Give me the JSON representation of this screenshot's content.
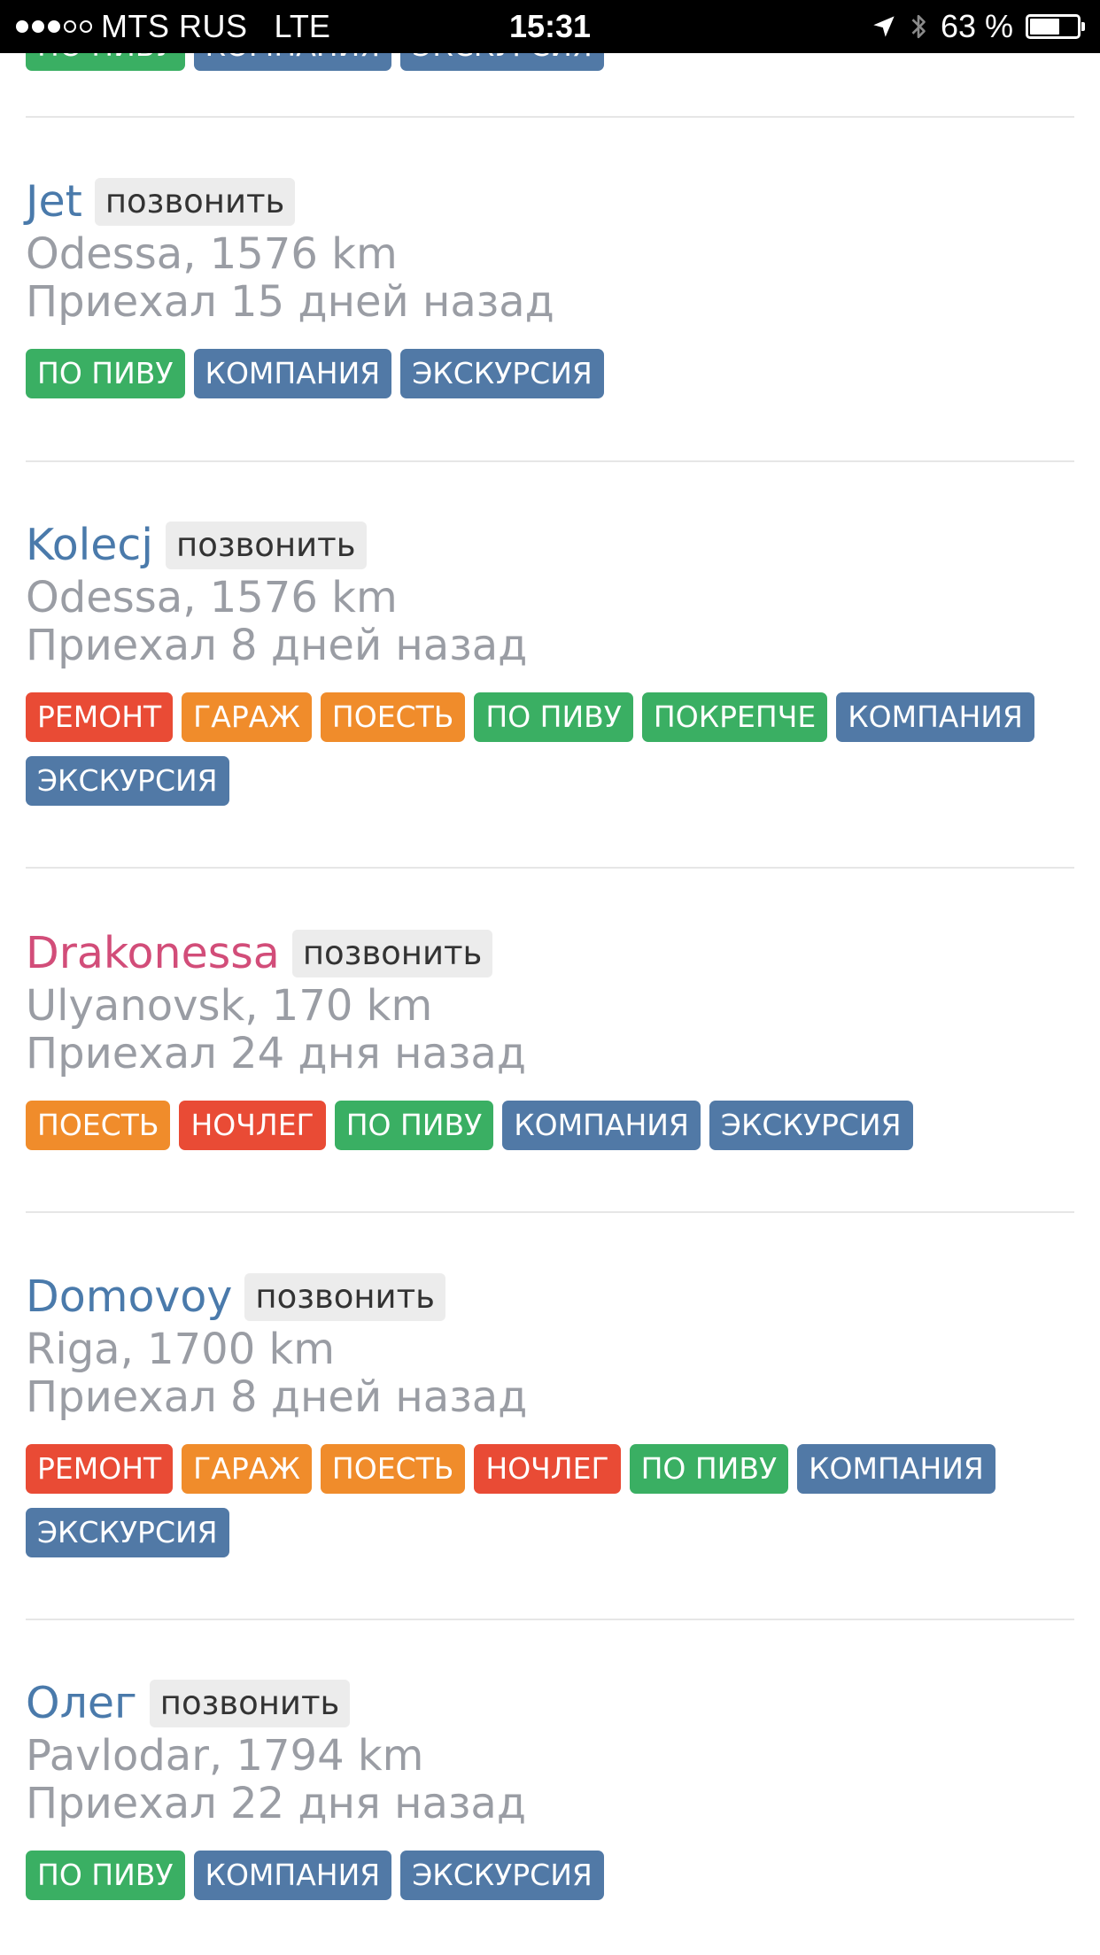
{
  "status_bar": {
    "carrier": "MTS RUS",
    "network": "LTE",
    "time": "15:31",
    "battery": "63 %",
    "battery_level": 0.63
  },
  "tag_colors": {
    "red": "#e94b35",
    "orange": "#f08c2b",
    "green": "#3aaf63",
    "blue": "#5179a6"
  },
  "call_label": "позвонить",
  "partial_top_tags": [
    {
      "label": "ПО ПИВУ",
      "color": "green"
    },
    {
      "label": "КОМПАНИЯ",
      "color": "blue"
    },
    {
      "label": "ЭКСКУРСИЯ",
      "color": "blue"
    }
  ],
  "bikers": [
    {
      "name": "Jet",
      "gender": "male",
      "city": "Odessa, 1576 km",
      "arrived": "Приехал 15 дней назад",
      "tags": [
        {
          "label": "ПО ПИВУ",
          "color": "green"
        },
        {
          "label": "КОМПАНИЯ",
          "color": "blue"
        },
        {
          "label": "ЭКСКУРСИЯ",
          "color": "blue"
        }
      ]
    },
    {
      "name": "Kolecj",
      "gender": "male",
      "city": "Odessa, 1576 km",
      "arrived": "Приехал 8 дней назад",
      "tags": [
        {
          "label": "РЕМОНТ",
          "color": "red"
        },
        {
          "label": "ГАРАЖ",
          "color": "orange"
        },
        {
          "label": "ПОЕСТЬ",
          "color": "orange"
        },
        {
          "label": "ПО ПИВУ",
          "color": "green"
        },
        {
          "label": "ПОКРЕПЧЕ",
          "color": "green"
        },
        {
          "label": "КОМПАНИЯ",
          "color": "blue"
        },
        {
          "label": "ЭКСКУРСИЯ",
          "color": "blue"
        }
      ]
    },
    {
      "name": "Drakonessa",
      "gender": "female",
      "city": "Ulyanovsk, 170 km",
      "arrived": "Приехал 24 дня назад",
      "tags": [
        {
          "label": "ПОЕСТЬ",
          "color": "orange"
        },
        {
          "label": "НОЧЛЕГ",
          "color": "red"
        },
        {
          "label": "ПО ПИВУ",
          "color": "green"
        },
        {
          "label": "КОМПАНИЯ",
          "color": "blue"
        },
        {
          "label": "ЭКСКУРСИЯ",
          "color": "blue"
        }
      ]
    },
    {
      "name": "Domovoy",
      "gender": "male",
      "city": "Riga, 1700 km",
      "arrived": "Приехал 8 дней назад",
      "tags": [
        {
          "label": "РЕМОНТ",
          "color": "red"
        },
        {
          "label": "ГАРАЖ",
          "color": "orange"
        },
        {
          "label": "ПОЕСТЬ",
          "color": "orange"
        },
        {
          "label": "НОЧЛЕГ",
          "color": "red"
        },
        {
          "label": "ПО ПИВУ",
          "color": "green"
        },
        {
          "label": "КОМПАНИЯ",
          "color": "blue"
        },
        {
          "label": "ЭКСКУРСИЯ",
          "color": "blue"
        }
      ]
    },
    {
      "name": "Олег",
      "gender": "male",
      "city": "Pavlodar, 1794 km",
      "arrived": "Приехал 22 дня назад",
      "tags": [
        {
          "label": "ПО ПИВУ",
          "color": "green"
        },
        {
          "label": "КОМПАНИЯ",
          "color": "blue"
        },
        {
          "label": "ЭКСКУРСИЯ",
          "color": "blue"
        }
      ]
    }
  ]
}
